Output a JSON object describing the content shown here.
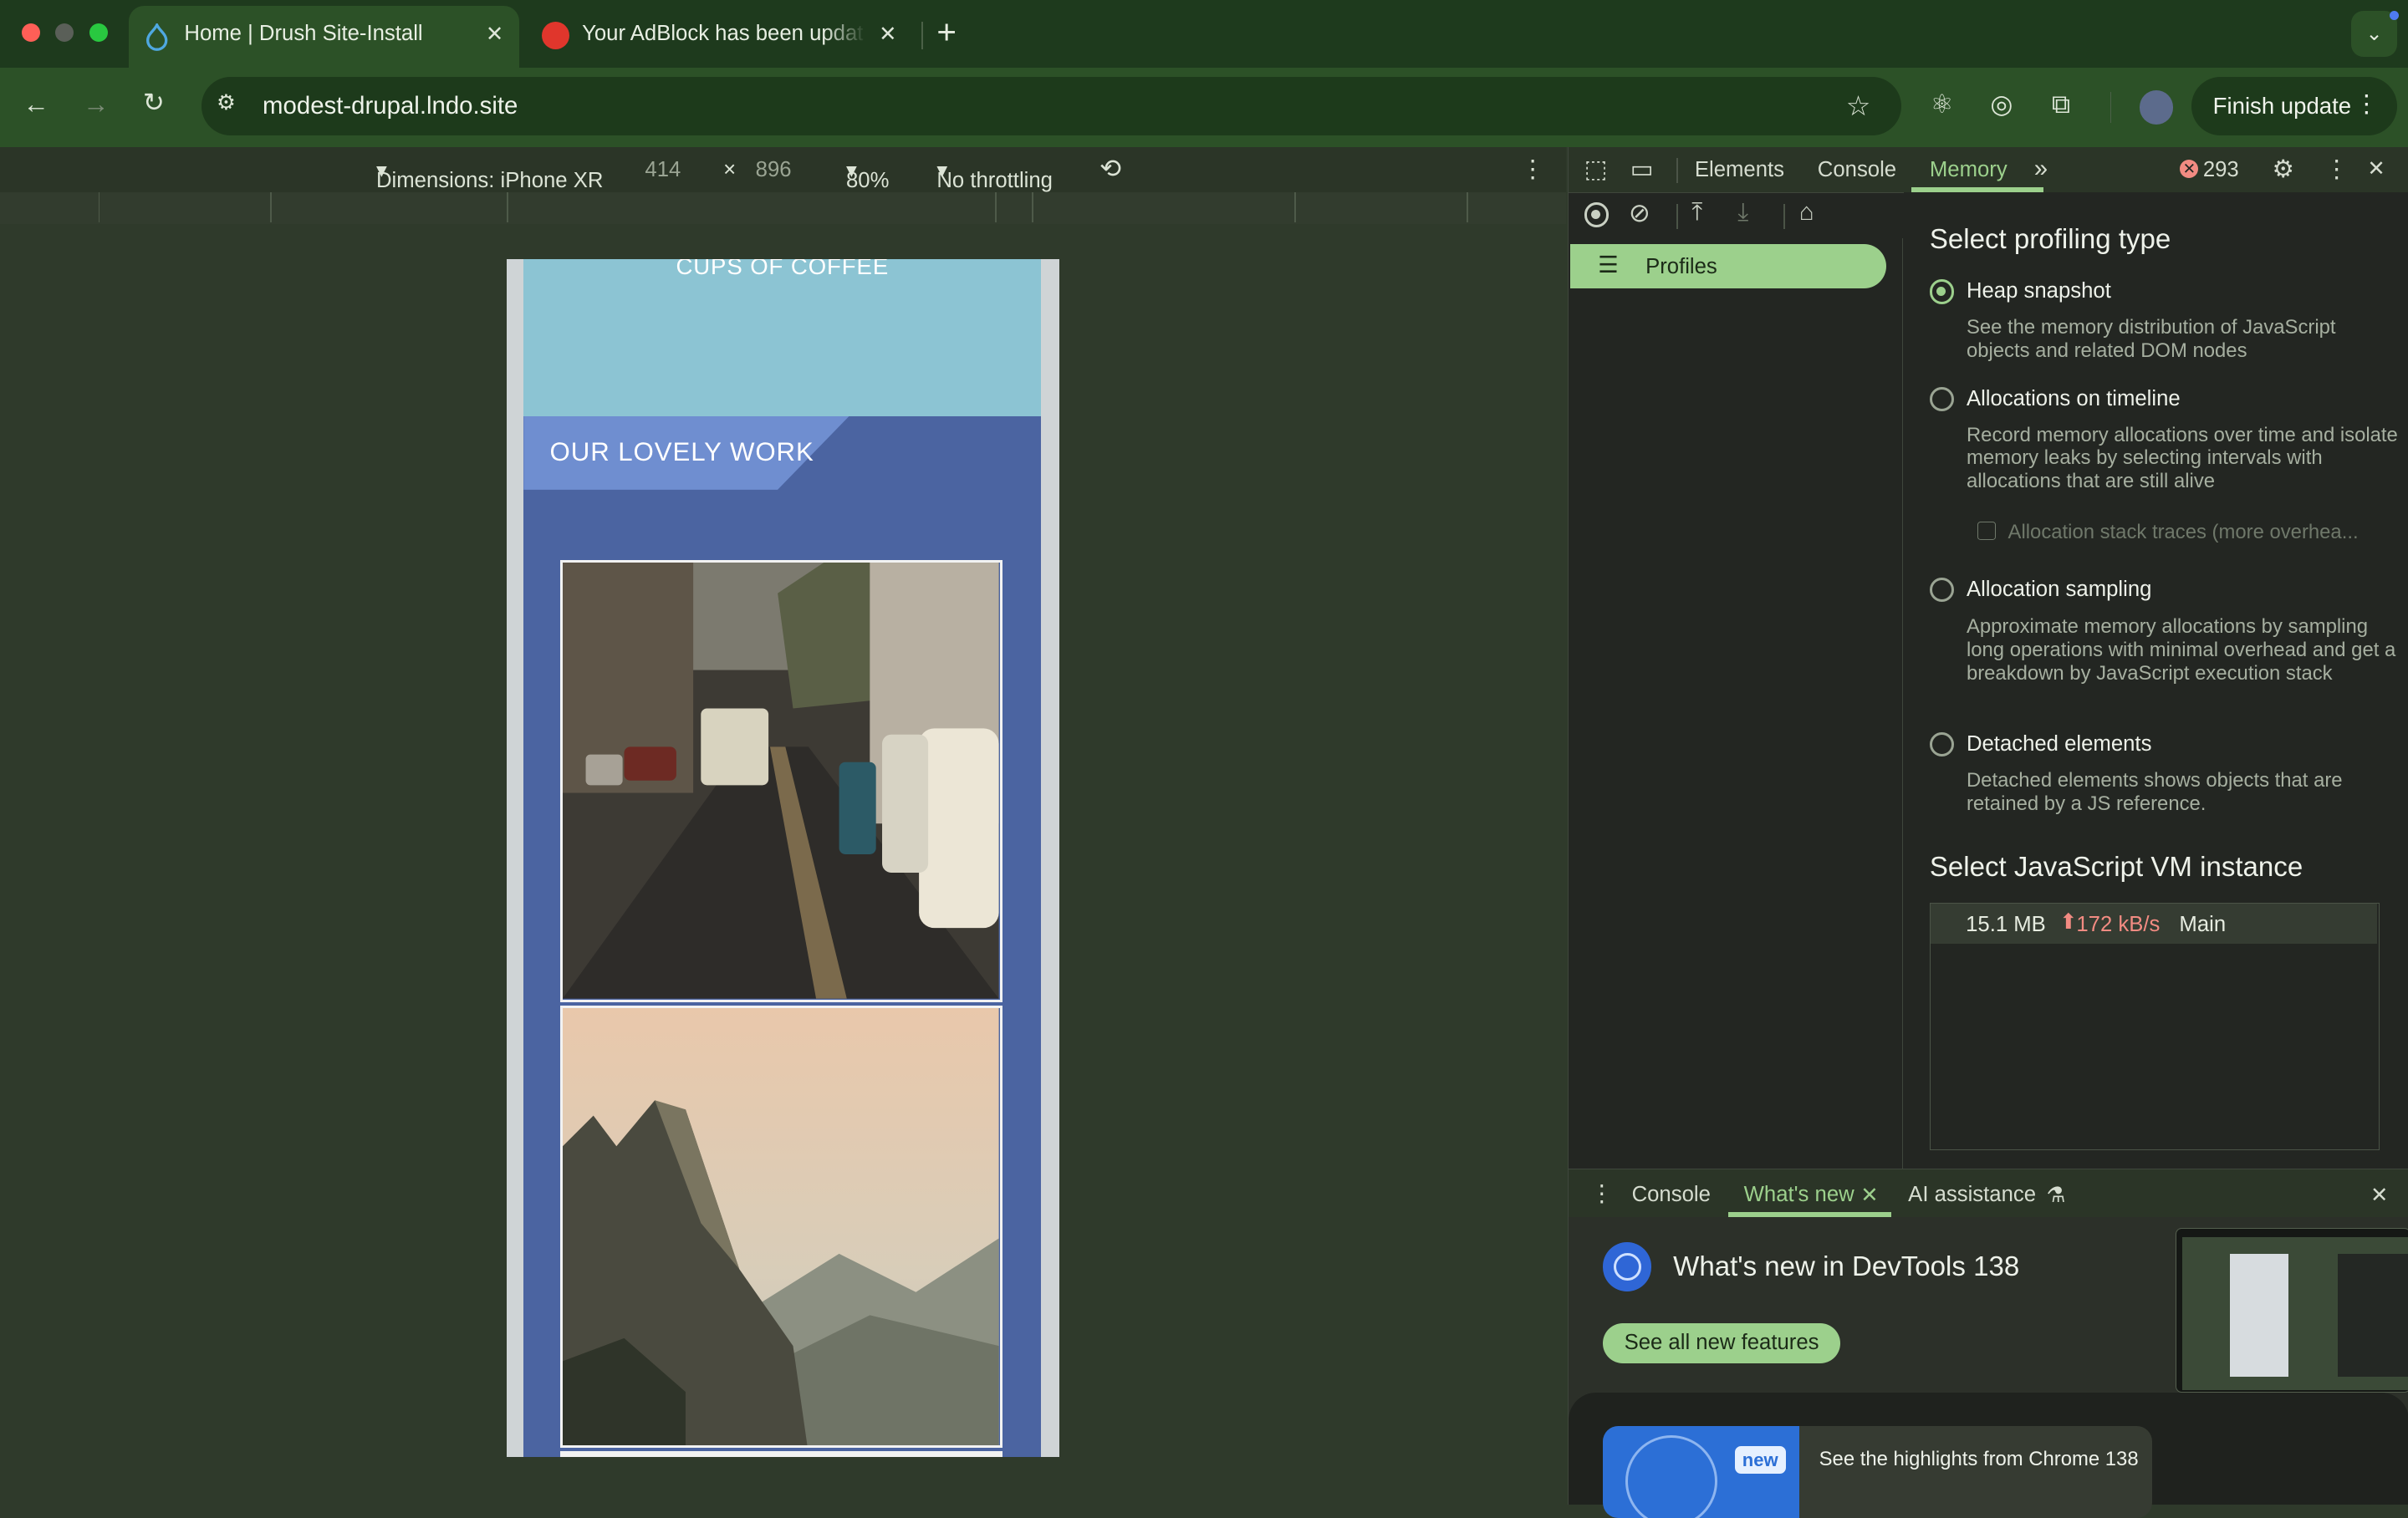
{
  "browser": {
    "tabs": [
      {
        "title": "Home | Drush Site-Install",
        "active": true,
        "icon": "drupal-drop-icon"
      },
      {
        "title": "Your AdBlock has been updat",
        "active": false,
        "icon": "adblock-hand-icon"
      }
    ],
    "new_tab": "+",
    "url": "modest-drupal.lndo.site",
    "finish_update": "Finish update"
  },
  "device_toolbar": {
    "dimensions": "Dimensions: iPhone XR",
    "width": "414",
    "times": "×",
    "height": "896",
    "zoom": "80%",
    "throttling": "No throttling"
  },
  "page": {
    "coffee": "CUPS OF COFFEE",
    "section_title": "OUR LOVELY WORK"
  },
  "devtools": {
    "tabs": [
      "Elements",
      "Console",
      "Memory"
    ],
    "active_tab": "Memory",
    "error_count": "293",
    "sidebar_item": "Profiles",
    "profiling_heading": "Select profiling type",
    "options": [
      {
        "label": "Heap snapshot",
        "desc": "See the memory distribution of JavaScript objects and related DOM nodes",
        "selected": true
      },
      {
        "label": "Allocations on timeline",
        "desc": "Record memory allocations over time and isolate memory leaks by selecting intervals with allocations that are still alive",
        "selected": false
      },
      {
        "label": "Allocation sampling",
        "desc": "Approximate memory allocations by sampling long operations with minimal overhead and get a breakdown by JavaScript execution stack",
        "selected": false
      },
      {
        "label": "Detached elements",
        "desc": "Detached elements shows objects that are retained by a JS reference.",
        "selected": false
      }
    ],
    "stack_traces": "Allocation stack traces (more overhea...",
    "vm_heading": "Select JavaScript VM instance",
    "vm": {
      "size": "15.1 MB",
      "rate": "172 kB/s",
      "name": "Main"
    },
    "drawer_tabs": [
      "Console",
      "What's new",
      "AI assistance"
    ],
    "whats_new_title": "What's new in DevTools 138",
    "see_all": "See all new features",
    "new_badge": "new",
    "highlights": "See the highlights from Chrome 138"
  },
  "colors": {
    "accent": "#9cd08c",
    "error": "#f28b82",
    "page_blue": "#4b64a1"
  }
}
